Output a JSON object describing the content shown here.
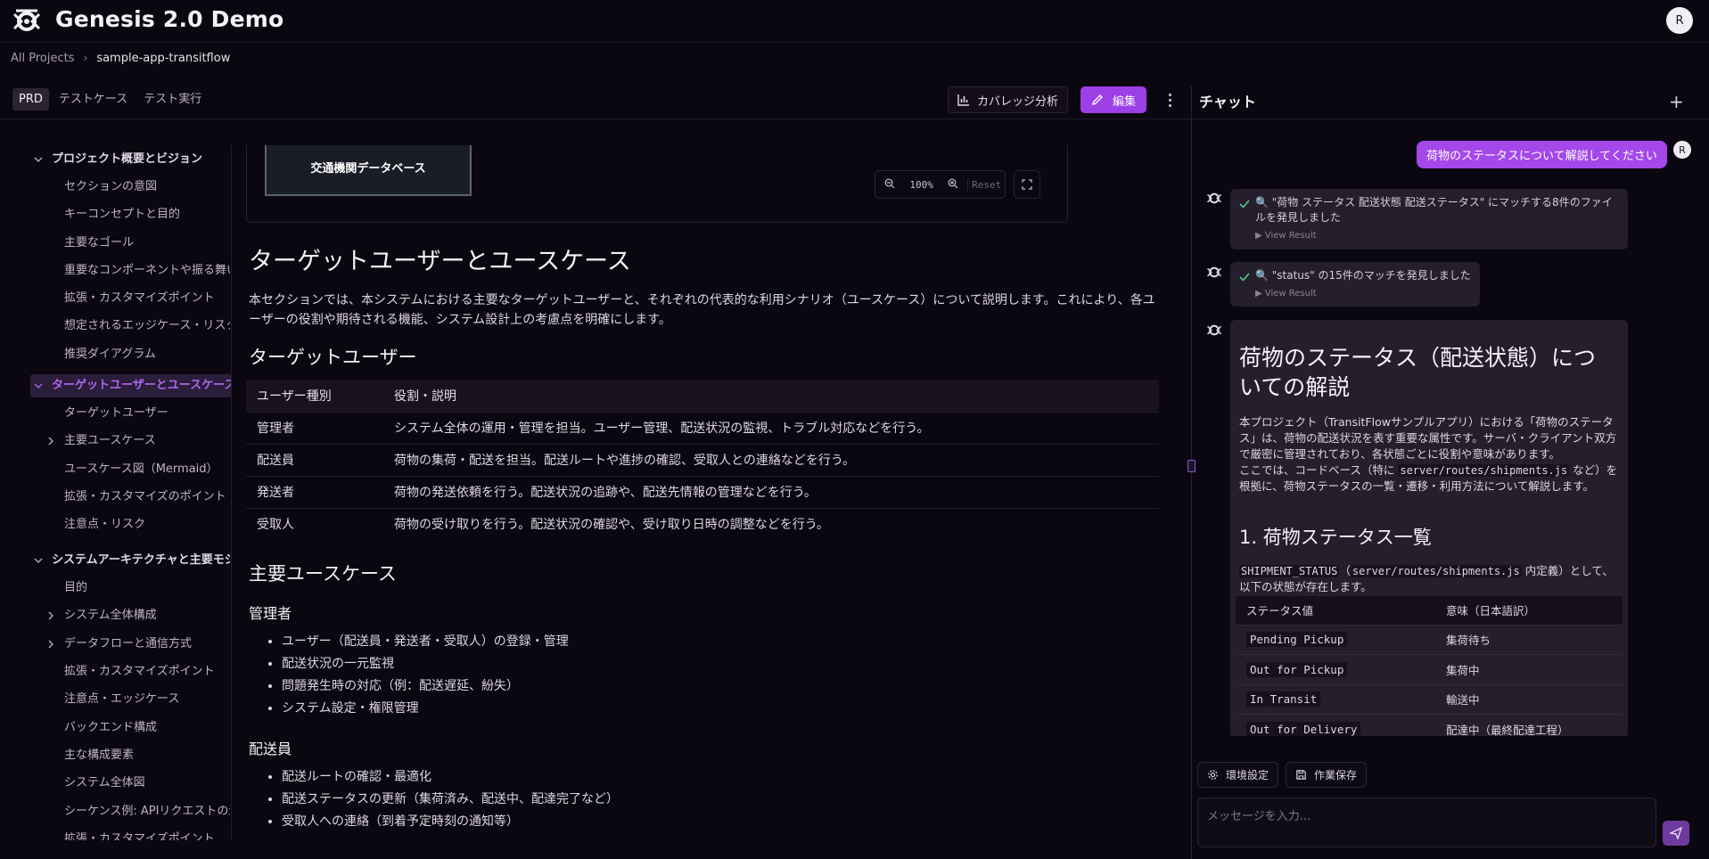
{
  "app": {
    "title": "Genesis 2.0 Demo",
    "user_initial": "R"
  },
  "breadcrumb": {
    "root": "All Projects",
    "current": "sample-app-transitflow"
  },
  "tabs": [
    "PRD",
    "テストケース",
    "テスト実行"
  ],
  "toolbar": {
    "coverage_label": "カバレッジ分析",
    "edit_label": "編集"
  },
  "sidebar": {
    "items": [
      "プロジェクト概要とビジョン",
      "セクションの意図",
      "キーコンセプトと目的",
      "主要なゴール",
      "重要なコンポーネントや振る舞い",
      "拡張・カスタマイズポイント",
      "想定されるエッジケース・リスク",
      "推奨ダイアグラム",
      "ターゲットユーザーとユースケース",
      "ターゲットユーザー",
      "主要ユースケース",
      "ユースケース図（Mermaid）",
      "拡張・カスタマイズのポイント",
      "注意点・リスク",
      "システムアーキテクチャと主要モジュール",
      "目的",
      "システム全体構成",
      "データフローと通信方式",
      "拡張・カスタマイズポイント",
      "注意点・エッジケース",
      "バックエンド構成",
      "主な構成要素",
      "システム全体図",
      "シーケンス例: APIリクエストの流れ",
      "拡張・カスタマイズポイント"
    ]
  },
  "diagram": {
    "node_label": "交通機関データベース",
    "zoom": "100%",
    "reset_label": "Reset"
  },
  "doc": {
    "h1": "ターゲットユーザーとユースケース",
    "intro": "本セクションでは、本システムにおける主要なターゲットユーザーと、それぞれの代表的な利用シナリオ（ユースケース）について説明します。これにより、各ユーザーの役割や期待される機能、システム設計上の考慮点を明確にします。",
    "h2_users": "ターゲットユーザー",
    "user_table": {
      "headers": [
        "ユーザー種別",
        "役割・説明"
      ],
      "rows": [
        [
          "管理者",
          "システム全体の運用・管理を担当。ユーザー管理、配送状況の監視、トラブル対応などを行う。"
        ],
        [
          "配送員",
          "荷物の集荷・配送を担当。配送ルートや進捗の確認、受取人との連絡などを行う。"
        ],
        [
          "発送者",
          "荷物の発送依頼を行う。配送状況の追跡や、配送先情報の管理などを行う。"
        ],
        [
          "受取人",
          "荷物の受け取りを行う。配送状況の確認や、受け取り日時の調整などを行う。"
        ]
      ]
    },
    "h2_usecases": "主要ユースケース",
    "h3_admin": "管理者",
    "admin_items": [
      "ユーザー（配送員・発送者・受取人）の登録・管理",
      "配送状況の一元監視",
      "問題発生時の対応（例：配送遅延、紛失）",
      "システム設定・権限管理"
    ],
    "h3_driver": "配送員",
    "driver_items": [
      "配送ルートの確認・最適化",
      "配送ステータスの更新（集荷済み、配送中、配達完了など）",
      "受取人への連絡（到着予定時刻の通知等）"
    ]
  },
  "chat": {
    "title": "チャット",
    "user_message": "荷物のステータスについて解説してください",
    "tool1_text": "🔍 \"荷物 ステータス 配送状態 配送ステータス\" にマッチする8件のファイルを発見しました",
    "tool2_text": "🔍 \"status\" の15件のマッチを発見しました",
    "view_result": "▶ View Result",
    "answer_title": "荷物のステータス（配送状態）についての解説",
    "answer_p1": "本プロジェクト（TransitFlowサンプルアプリ）における「荷物のステータス」は、荷物の配送状況を表す重要な属性です。サーバ・クライアント双方で厳密に管理されており、各状態ごとに役割や意味があります。",
    "answer_p2_a": "ここでは、コードベース（特に ",
    "answer_p2_code": "server/routes/shipments.js",
    "answer_p2_b": " など）を根拠に、荷物ステータスの一覧・遷移・利用方法について解説します。",
    "answer_h2": "1. 荷物ステータス一覧",
    "answer_p3_code1": "SHIPMENT_STATUS",
    "answer_p3_a": "（",
    "answer_p3_code2": "server/routes/shipments.js",
    "answer_p3_b": " 内定義）として、以下の状態が存在します。",
    "status_table": {
      "headers": [
        "ステータス値",
        "意味（日本語訳）"
      ],
      "rows": [
        [
          "Pending Pickup",
          "集荷待ち"
        ],
        [
          "Out for Pickup",
          "集荷中"
        ],
        [
          "In Transit",
          "輸送中"
        ],
        [
          "Out for Delivery",
          "配達中（最終配達工程）"
        ]
      ]
    },
    "chip_settings": "環境設定",
    "chip_save": "作業保存",
    "input_placeholder": "メッセージを入力..."
  },
  "colors": {
    "accent": "#9d3fe6",
    "background": "#0b0711",
    "card": "#241e2d"
  }
}
